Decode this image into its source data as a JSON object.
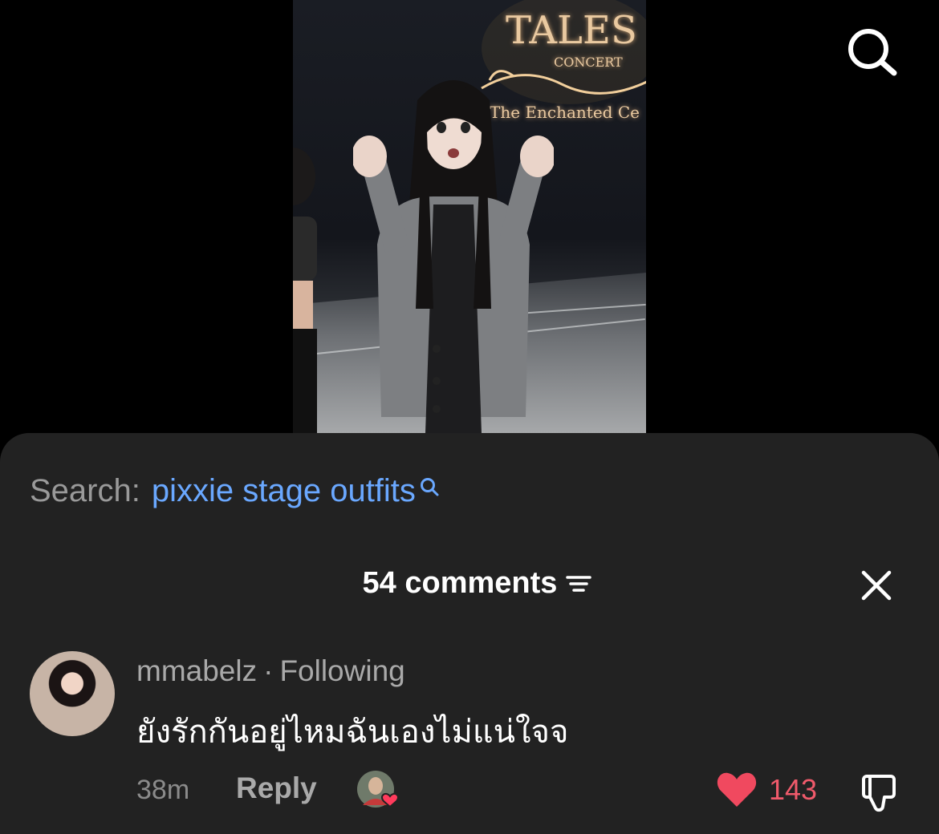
{
  "video": {
    "sign_lines": [
      "TALES",
      "CONCERT",
      "The Enchanted Ce"
    ]
  },
  "top_search_icon": "search-icon",
  "search": {
    "label": "Search:",
    "query": "pixxie stage outfits"
  },
  "comments": {
    "count_label": "54 comments",
    "filter_icon": "filter-icon",
    "close_icon": "close-icon"
  },
  "comment": {
    "username": "mmabelz",
    "separator": "·",
    "relation": "Following",
    "text": "ยังรักกันอยู่ไหมฉันเองไม่แน่ใจจ",
    "time": "38m",
    "reply_label": "Reply",
    "likes": "143"
  },
  "colors": {
    "link_blue": "#6aa8ff",
    "like_red": "#f05a6b",
    "sheet_bg": "#222222"
  }
}
